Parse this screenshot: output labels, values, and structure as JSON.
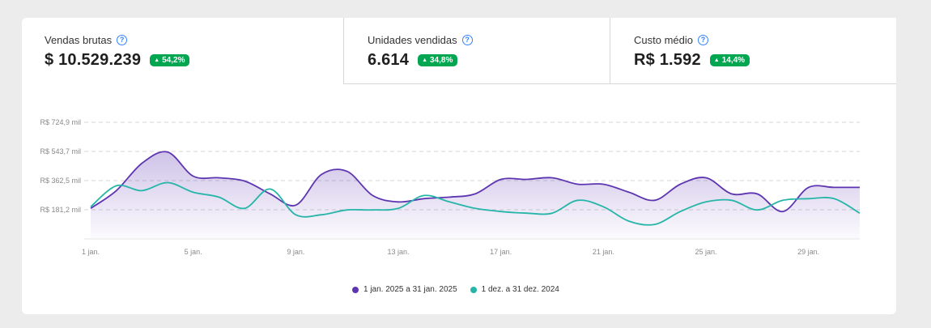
{
  "metrics": [
    {
      "title": "Vendas brutas",
      "value": "$ 10.529.239",
      "change": "54,2%"
    },
    {
      "title": "Unidades vendidas",
      "value": "6.614",
      "change": "34,8%"
    },
    {
      "title": "Custo médio",
      "value": "R$ 1.592",
      "change": "14,4%"
    }
  ],
  "colors": {
    "current": "#5e35b1",
    "previous": "#26b5a8",
    "badge": "#00a650",
    "help": "#3483fa"
  },
  "icons": {
    "help": "help-circle-icon",
    "up": "triangle-up-icon"
  },
  "chart_data": {
    "type": "area",
    "y_ticks": [
      "R$ 724,9 mil",
      "R$ 543,7 mil",
      "R$ 362,5 mil",
      "R$ 181,2 mil"
    ],
    "y_tick_values": [
      724.9,
      543.7,
      362.5,
      181.2
    ],
    "ylim": [
      0,
      724.9
    ],
    "x_ticks": [
      "1 jan.",
      "5 jan.",
      "9 jan.",
      "13 jan.",
      "17 jan.",
      "21 jan.",
      "25 jan.",
      "29 jan."
    ],
    "x_tick_days": [
      1,
      5,
      9,
      13,
      17,
      21,
      25,
      29
    ],
    "x": [
      1,
      2,
      3,
      4,
      5,
      6,
      7,
      8,
      9,
      10,
      11,
      12,
      13,
      14,
      15,
      16,
      17,
      18,
      19,
      20,
      21,
      22,
      23,
      24,
      25,
      26,
      27,
      28,
      29,
      30,
      31
    ],
    "series": [
      {
        "name": "1 jan. 2025 a 31 jan. 2025",
        "values": [
          190,
          300,
          470,
          540,
          390,
          380,
          360,
          280,
          210,
          400,
          420,
          270,
          230,
          250,
          260,
          280,
          370,
          370,
          380,
          340,
          340,
          290,
          240,
          340,
          380,
          280,
          280,
          170,
          320,
          320,
          320
        ]
      },
      {
        "name": "1 dez. a 31 dez. 2024",
        "values": [
          200,
          330,
          300,
          350,
          290,
          260,
          190,
          310,
          150,
          150,
          180,
          180,
          190,
          270,
          230,
          190,
          170,
          160,
          160,
          240,
          200,
          110,
          90,
          170,
          230,
          240,
          180,
          240,
          250,
          250,
          160
        ]
      }
    ],
    "grid": true,
    "legend": "bottom-center"
  }
}
